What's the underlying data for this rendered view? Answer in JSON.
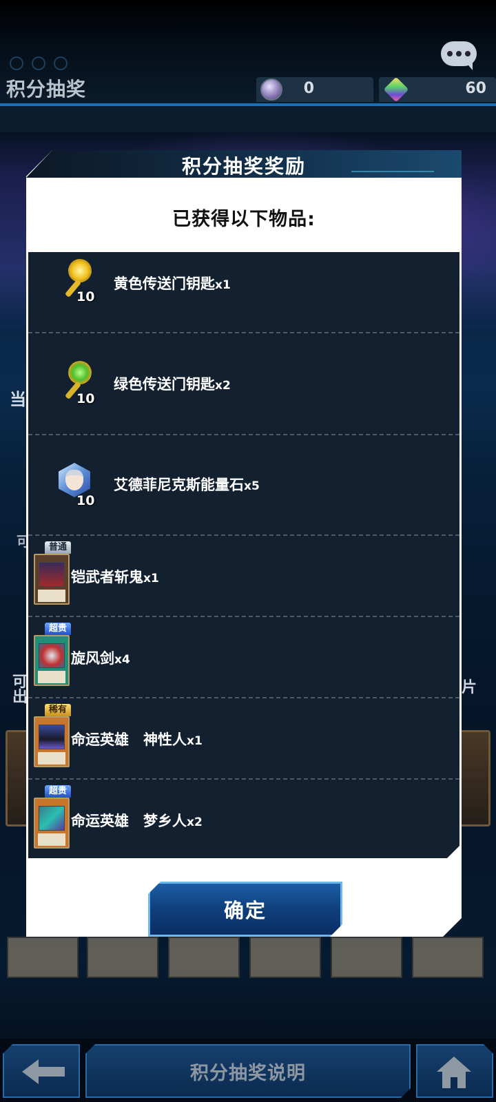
{
  "header": {
    "title": "积分抽奖",
    "points": "0",
    "gems": "60"
  },
  "background_labels": {
    "left_1": "当",
    "left_2": "可",
    "left_3": "可出",
    "right_1": "片"
  },
  "dialog": {
    "title": "积分抽奖奖励",
    "subtitle": "已获得以下物品:",
    "items": [
      {
        "name": "黄色传送门钥匙",
        "qty": "x1",
        "icon": "yellow-key-icon",
        "badge": "10"
      },
      {
        "name": "绿色传送门钥匙",
        "qty": "x2",
        "icon": "green-key-icon",
        "badge": "10"
      },
      {
        "name": "艾德菲尼克斯能量石",
        "qty": "x5",
        "icon": "energy-stone-icon",
        "badge": "10"
      },
      {
        "name": "铠武者斩鬼",
        "qty": "x1",
        "rarity": "普通",
        "icon": "card-icon"
      },
      {
        "name": "旋风剑",
        "qty": "x4",
        "rarity": "超贵",
        "icon": "card-icon"
      },
      {
        "name": "命运英雄　神性人",
        "qty": "x1",
        "rarity": "稀有",
        "icon": "card-icon"
      },
      {
        "name": "命运英雄　梦乡人",
        "qty": "x2",
        "rarity": "超贵",
        "icon": "card-icon"
      }
    ],
    "confirm_label": "确定"
  },
  "bottom_bar": {
    "back_icon": "back-arrow-icon",
    "help_label": "积分抽奖说明",
    "home_icon": "home-icon"
  },
  "colors": {
    "accent_blue": "#1b6fb6",
    "list_bg": "#122030",
    "dialog_bg": "#ffffff"
  }
}
